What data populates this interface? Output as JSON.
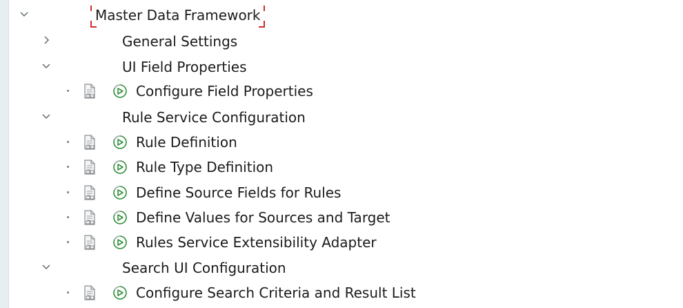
{
  "tree": {
    "root": {
      "label": "Master Data Framework",
      "state": "expanded",
      "icon": "chevron-down-icon"
    },
    "nodes": [
      {
        "type": "folder",
        "label": "General Settings",
        "state": "collapsed",
        "icon": "chevron-right-icon"
      },
      {
        "type": "folder",
        "label": "UI Field Properties",
        "state": "expanded",
        "icon": "chevron-down-icon"
      },
      {
        "type": "activity",
        "label": "Configure Field Properties",
        "icons": [
          "document-icon",
          "execute-icon"
        ]
      },
      {
        "type": "folder",
        "label": "Rule Service Configuration",
        "state": "expanded",
        "icon": "chevron-down-icon"
      },
      {
        "type": "activity",
        "label": "Rule Definition",
        "icons": [
          "document-icon",
          "execute-icon"
        ]
      },
      {
        "type": "activity",
        "label": "Rule Type Definition",
        "icons": [
          "document-icon",
          "execute-icon"
        ]
      },
      {
        "type": "activity",
        "label": "Define Source Fields for Rules",
        "icons": [
          "document-icon",
          "execute-icon"
        ]
      },
      {
        "type": "activity",
        "label": "Define Values for Sources and Target",
        "icons": [
          "document-icon",
          "execute-icon"
        ]
      },
      {
        "type": "activity",
        "label": "Rules Service Extensibility Adapter",
        "icons": [
          "document-icon",
          "execute-icon"
        ]
      },
      {
        "type": "folder",
        "label": "Search UI Configuration",
        "state": "expanded",
        "icon": "chevron-down-icon"
      },
      {
        "type": "activity",
        "label": "Configure Search Criteria and Result List",
        "icons": [
          "document-icon",
          "execute-icon"
        ]
      }
    ]
  },
  "colors": {
    "focus_corner": "#cc2b2b",
    "execute_icon": "#2f8f3a",
    "text": "#1a1a1a"
  }
}
